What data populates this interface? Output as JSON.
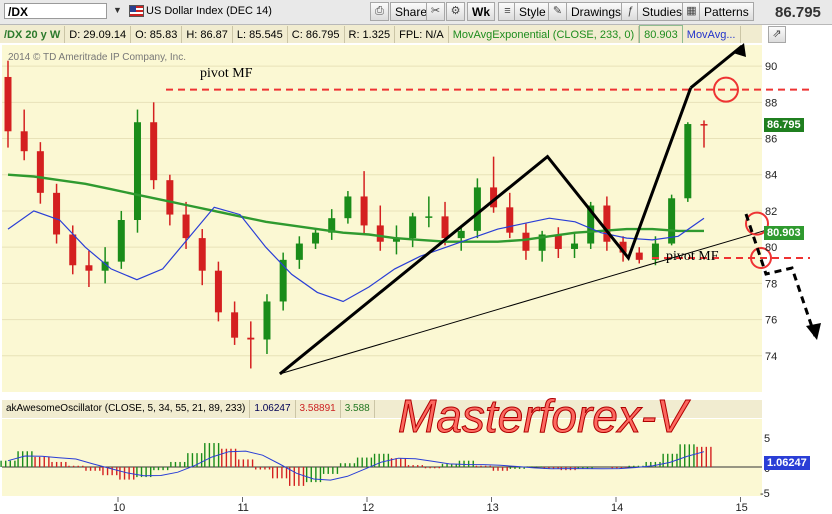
{
  "toolbar": {
    "symbol": "/DX",
    "description": "US Dollar Index (DEC 14)",
    "buttons": [
      "Share",
      "Wk",
      "Style",
      "Drawings",
      "Studies",
      "Patterns"
    ],
    "last_price": "86.795"
  },
  "info_bar": {
    "symbol_period": "/DX 20 y W",
    "date": "D: 29.09.14",
    "open": "O: 85.83",
    "high": "H: 86.87",
    "low": "L: 85.545",
    "close": "C: 86.795",
    "range": "R: 1.325",
    "fpl": "FPL: N/A",
    "study": "MovAvgExponential (CLOSE, 233, 0)",
    "study_value": "80.903",
    "study2": "MovAvg..."
  },
  "copyright": "2014 © TD Ameritrade IP Company, Inc.",
  "annotations": {
    "pivot_top": "pivot MF",
    "pivot_bottom": "pivot MF",
    "watermark": "Masterforex-V"
  },
  "oscillator": {
    "name": "akAwesomeOscillator (CLOSE, 5, 34, 55, 21, 89, 233)",
    "v1": "1.06247",
    "v2": "3.58891",
    "v3": "3.588",
    "axis_ticks": [
      "5",
      "0",
      "-5"
    ],
    "value_tag": "1.06247"
  },
  "price_tags": {
    "last": "86.795",
    "ema": "80.903"
  },
  "colors": {
    "up": "#1a8c1a",
    "down": "#d42020",
    "ema233": "#2f9a2f",
    "ma_blue": "#2a3ed6",
    "panel_bg": "#fbf8d3",
    "pivot_red": "#ee3333"
  },
  "chart_data": {
    "type": "candlestick",
    "ylim": [
      72,
      91
    ],
    "yticks": [
      74,
      76,
      78,
      80,
      82,
      84,
      86,
      88,
      90
    ],
    "x_labels": [
      "10",
      "11",
      "12",
      "13",
      "14",
      "15"
    ],
    "series": [
      {
        "name": "MovAvgExponential (CLOSE, 233, 0)",
        "values": [
          84.0,
          83.9,
          83.7,
          83.5,
          83.2,
          82.9,
          82.6,
          82.3,
          82.0,
          81.7,
          81.4,
          81.2,
          81.0,
          80.8,
          80.7,
          80.5,
          80.4,
          80.3,
          80.3,
          80.3,
          80.4,
          80.6,
          80.8,
          80.9,
          81.0,
          81.0,
          80.9,
          80.9
        ]
      },
      {
        "name": "MovAvg",
        "values": [
          81.0,
          82.0,
          81.5,
          80.0,
          78.8,
          78.2,
          78.8,
          80.5,
          82.2,
          81.8,
          80.0,
          78.5,
          77.5,
          77.0,
          77.8,
          78.8,
          79.5,
          80.0,
          80.5,
          81.0,
          81.3,
          81.6,
          81.4,
          80.8,
          80.5,
          80.4,
          80.6,
          81.6
        ]
      }
    ],
    "candles": {
      "open": [
        89.4,
        86.4,
        85.3,
        83.0,
        80.7,
        79.0,
        78.7,
        79.2,
        81.5,
        86.9,
        83.7,
        81.8,
        80.5,
        78.7,
        76.4,
        75.0,
        74.9,
        77.0,
        79.3,
        80.2,
        80.8,
        81.6,
        82.8,
        81.2,
        80.3,
        80.5,
        81.7,
        81.7,
        80.5,
        80.9,
        83.3,
        82.2,
        80.8,
        79.8,
        80.7,
        79.9,
        80.2,
        82.3,
        80.3,
        79.7,
        79.3,
        80.2,
        82.7,
        86.8
      ],
      "high": [
        90.3,
        87.6,
        85.8,
        83.5,
        81.2,
        79.8,
        80.0,
        82.0,
        87.6,
        88.0,
        84.0,
        82.5,
        81.0,
        79.2,
        77.0,
        75.9,
        77.4,
        79.7,
        80.6,
        81.0,
        82.1,
        83.1,
        84.2,
        82.3,
        81.2,
        81.9,
        82.8,
        82.5,
        81.2,
        83.8,
        85.0,
        83.0,
        81.3,
        80.9,
        81.1,
        80.8,
        82.5,
        82.8,
        80.6,
        80.0,
        80.6,
        82.9,
        86.9,
        87.0
      ],
      "low": [
        85.5,
        84.8,
        82.4,
        80.2,
        78.5,
        77.8,
        78.0,
        78.8,
        80.8,
        83.2,
        81.2,
        79.9,
        77.9,
        75.9,
        74.6,
        73.3,
        74.1,
        76.5,
        78.8,
        79.9,
        80.4,
        81.3,
        80.7,
        79.8,
        79.6,
        80.0,
        81.1,
        80.1,
        79.8,
        80.5,
        81.9,
        80.5,
        79.3,
        79.2,
        79.4,
        79.4,
        79.9,
        79.8,
        79.2,
        79.1,
        79.0,
        80.1,
        82.5,
        85.5
      ],
      "close": [
        86.4,
        85.3,
        83.0,
        80.7,
        79.0,
        78.7,
        79.2,
        81.5,
        86.9,
        83.7,
        81.8,
        80.5,
        78.7,
        76.4,
        75.0,
        74.9,
        77.0,
        79.3,
        80.2,
        80.8,
        81.6,
        82.8,
        81.2,
        80.3,
        80.5,
        81.7,
        81.7,
        80.5,
        80.9,
        83.3,
        82.2,
        80.8,
        79.8,
        80.7,
        79.9,
        80.2,
        82.3,
        80.3,
        79.7,
        79.3,
        80.2,
        82.7,
        86.8,
        86.795
      ]
    },
    "trendlines": [
      {
        "from": [
          "11.3",
          73.0
        ],
        "to": [
          "14.6",
          88.8
        ]
      },
      {
        "from": [
          "11.3",
          73.0
        ],
        "to": [
          "13.45",
          85.0
        ]
      }
    ],
    "pivot_levels": [
      88.7,
      79.4
    ],
    "oscillator_ylim": [
      -6,
      7
    ],
    "oscillator_values": [
      1.0,
      2.5,
      1.6,
      0.8,
      0.2,
      -0.6,
      -1.3,
      -2.0,
      -1.6,
      -0.5,
      0.8,
      2.2,
      3.8,
      2.9,
      1.2,
      -0.4,
      -1.8,
      -3.0,
      -2.4,
      -1.1,
      0.6,
      1.5,
      2.1,
      1.4,
      0.3,
      -0.2,
      0.5,
      1.0,
      0.2,
      -0.6,
      -0.3,
      0.1,
      -0.3,
      -0.5,
      -0.3,
      0.0,
      -0.2,
      0.2,
      0.8,
      2.1,
      3.6,
      3.2
    ]
  }
}
